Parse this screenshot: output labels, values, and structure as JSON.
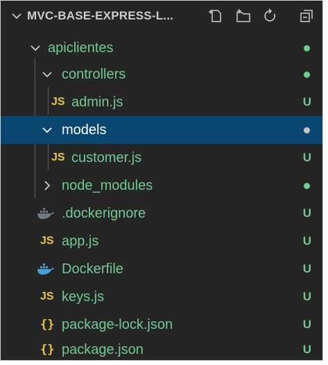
{
  "explorer": {
    "title": "MVC-BASE-EXPRESS-L...",
    "actions": [
      "new-file-icon",
      "new-folder-icon",
      "refresh-icon",
      "collapse-all-icon"
    ]
  },
  "tree": [
    {
      "label": "apiclientes",
      "type": "folder",
      "expanded": true,
      "status": "dot"
    },
    {
      "label": "controllers",
      "type": "folder",
      "expanded": true,
      "status": "dot"
    },
    {
      "label": "admin.js",
      "type": "js",
      "status": "U"
    },
    {
      "label": "models",
      "type": "folder",
      "expanded": true,
      "status": "dot",
      "selected": true
    },
    {
      "label": "customer.js",
      "type": "js",
      "status": "U"
    },
    {
      "label": "node_modules",
      "type": "folder",
      "expanded": false,
      "status": "dot"
    },
    {
      "label": ".dockerignore",
      "type": "docker",
      "status": "U"
    },
    {
      "label": "app.js",
      "type": "js",
      "status": "U"
    },
    {
      "label": "Dockerfile",
      "type": "docker",
      "status": "U"
    },
    {
      "label": "keys.js",
      "type": "js",
      "status": "U"
    },
    {
      "label": "package-lock.json",
      "type": "json",
      "status": "U"
    },
    {
      "label": "package.json",
      "type": "json",
      "status": "U"
    }
  ],
  "icons": {
    "js": "JS",
    "json": "{}"
  },
  "colors": {
    "background": "#252526",
    "selected": "#094771",
    "untracked": "#73c991",
    "js_icon": "#e8c547",
    "docker_icon": "#4b9fd5"
  }
}
